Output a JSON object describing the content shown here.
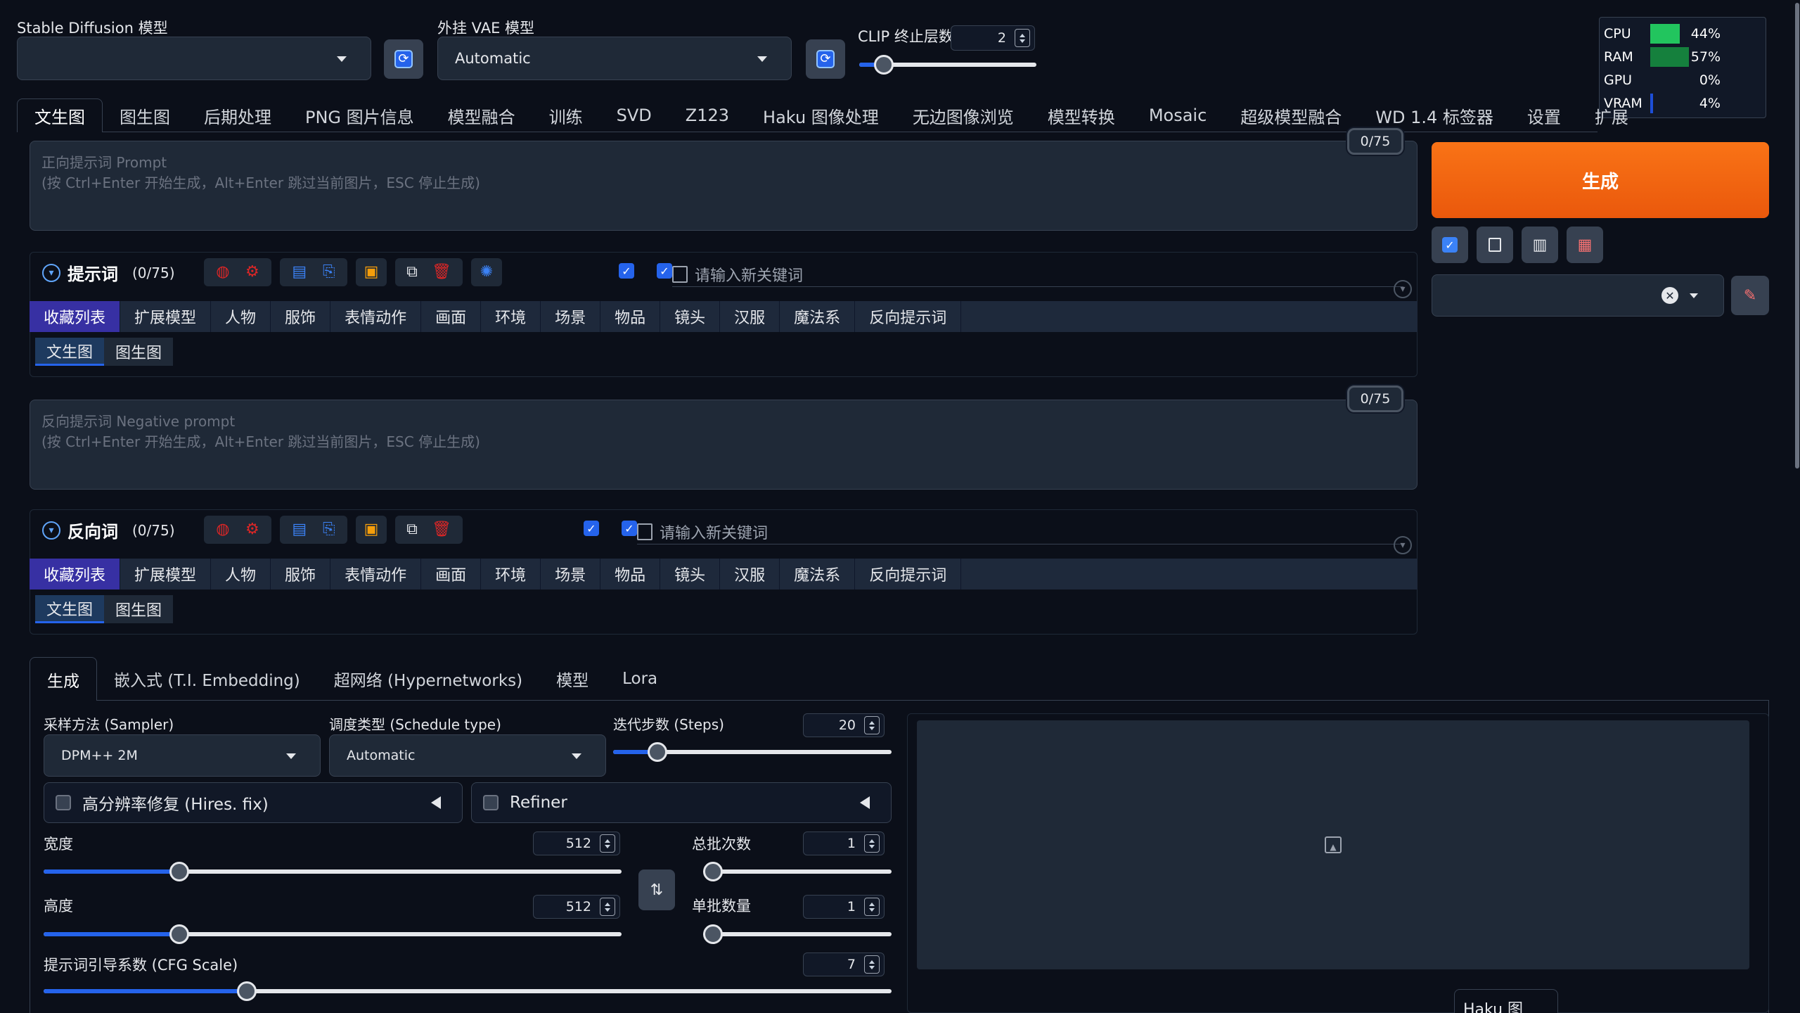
{
  "header": {
    "sd_model_label": "Stable Diffusion 模型",
    "sd_model_value": "",
    "vae_label": "外挂 VAE 模型",
    "vae_value": "Automatic",
    "clip_label": "CLIP 终止层数",
    "clip_value": "2",
    "clip_fraction": 0.14
  },
  "stats": [
    {
      "name": "CPU",
      "value": "44%",
      "fraction": 0.44,
      "color": "#22c55e"
    },
    {
      "name": "RAM",
      "value": "57%",
      "fraction": 0.57,
      "color": "#15803d"
    },
    {
      "name": "GPU",
      "value": "0%",
      "fraction": 0.0,
      "color": "#16a34a"
    },
    {
      "name": "VRAM",
      "value": "4%",
      "fraction": 0.04,
      "color": "#1d4ed8"
    }
  ],
  "main_tabs": [
    "文生图",
    "图生图",
    "后期处理",
    "PNG 图片信息",
    "模型融合",
    "训练",
    "SVD",
    "Z123",
    "Haku 图像处理",
    "无边图像浏览",
    "模型转换",
    "Mosaic",
    "超级模型融合",
    "WD 1.4 标签器",
    "设置",
    "扩展"
  ],
  "prompt": {
    "placeholder_line1": "正向提示词 Prompt",
    "placeholder_line2": "(按 Ctrl+Enter 开始生成，Alt+Enter 跳过当前图片，ESC 停止生成)",
    "counter": "0/75"
  },
  "negative": {
    "placeholder_line1": "反向提示词 Negative prompt",
    "placeholder_line2": "(按 Ctrl+Enter 开始生成，Alt+Enter 跳过当前图片，ESC 停止生成)",
    "counter": "0/75"
  },
  "prompt_helper": {
    "title": "提示词",
    "count": "(0/75)",
    "keyword_placeholder": "请输入新关键词"
  },
  "negative_helper": {
    "title": "反向词",
    "count": "(0/75)",
    "keyword_placeholder": "请输入新关键词"
  },
  "categories": [
    "收藏列表",
    "扩展模型",
    "人物",
    "服饰",
    "表情动作",
    "画面",
    "环境",
    "场景",
    "物品",
    "镜头",
    "汉服",
    "魔法系",
    "反向提示词"
  ],
  "sub_tabs": [
    "文生图",
    "图生图"
  ],
  "generate_label": "生成",
  "lower_tabs": [
    "生成",
    "嵌入式 (T.I. Embedding)",
    "超网络 (Hypernetworks)",
    "模型",
    "Lora"
  ],
  "sampler": {
    "label": "采样方法 (Sampler)",
    "value": "DPM++ 2M"
  },
  "schedule": {
    "label": "调度类型 (Schedule type)",
    "value": "Automatic"
  },
  "steps": {
    "label": "迭代步数 (Steps)",
    "value": "20",
    "fraction": 0.16
  },
  "hires": {
    "label": "高分辨率修复 (Hires. fix)"
  },
  "refiner": {
    "label": "Refiner"
  },
  "width": {
    "label": "宽度",
    "value": "512",
    "fraction": 0.235
  },
  "height": {
    "label": "高度",
    "value": "512",
    "fraction": 0.235
  },
  "batch_count": {
    "label": "总批次数",
    "value": "1",
    "fraction": 0.0
  },
  "batch_size": {
    "label": "单批数量",
    "value": "1",
    "fraction": 0.0
  },
  "cfg": {
    "label": "提示词引导系数 (CFG Scale)",
    "value": "7",
    "fraction": 0.24
  },
  "haku_label": "Haku 图"
}
